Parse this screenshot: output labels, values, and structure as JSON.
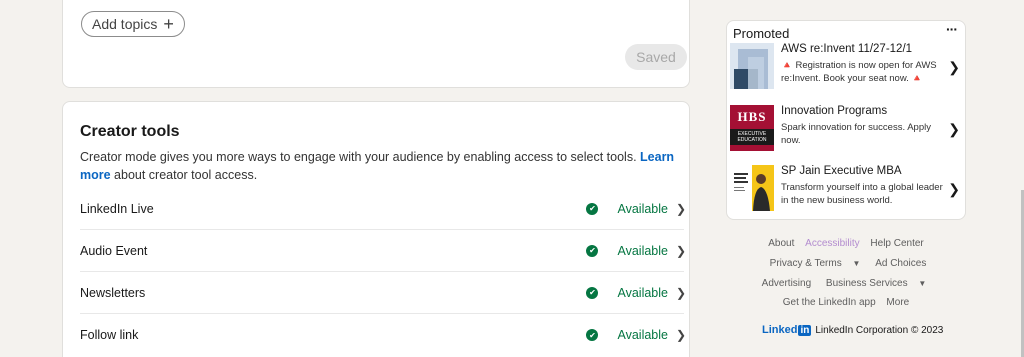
{
  "topics": {
    "add_label": "Add topics",
    "add_icon": "plus-icon",
    "saved_label": "Saved"
  },
  "creator_tools": {
    "title": "Creator tools",
    "description_pre": "Creator mode gives you more ways to engage with your audience by enabling access to select tools. ",
    "learn_more": "Learn more",
    "description_post": " about creator tool access.",
    "tools": [
      {
        "name": "LinkedIn Live",
        "status": "Available"
      },
      {
        "name": "Audio Event",
        "status": "Available"
      },
      {
        "name": "Newsletters",
        "status": "Available"
      },
      {
        "name": "Follow link",
        "status": "Available"
      }
    ],
    "status_color": "#057642"
  },
  "promoted": {
    "heading": "Promoted",
    "more_label": "···",
    "ads": [
      {
        "title": "AWS re:Invent 11/27-12/1",
        "body": "🔺 Registration is now open for AWS re:Invent. Book your seat now. 🔺"
      },
      {
        "title": "Innovation Programs",
        "body": "Spark innovation for success. Apply now."
      },
      {
        "title": "SP Jain Executive MBA",
        "body": "Transform yourself into a global leader in the new business world."
      }
    ],
    "hbs_logo": {
      "line1": "HBS",
      "line2": "EXECUTIVE EDUCATION"
    }
  },
  "footer": {
    "about": "About",
    "accessibility": "Accessibility",
    "help_center": "Help Center",
    "privacy_terms": "Privacy & Terms",
    "ad_choices": "Ad Choices",
    "advertising": "Advertising",
    "business_services": "Business Services",
    "get_app": "Get the LinkedIn app",
    "more": "More",
    "brand_word": "Linked",
    "brand_in": "in",
    "copyright": "LinkedIn Corporation © 2023"
  },
  "colors": {
    "link_blue": "#0a66c2",
    "available_green": "#057642",
    "background": "#f4f2ee"
  }
}
